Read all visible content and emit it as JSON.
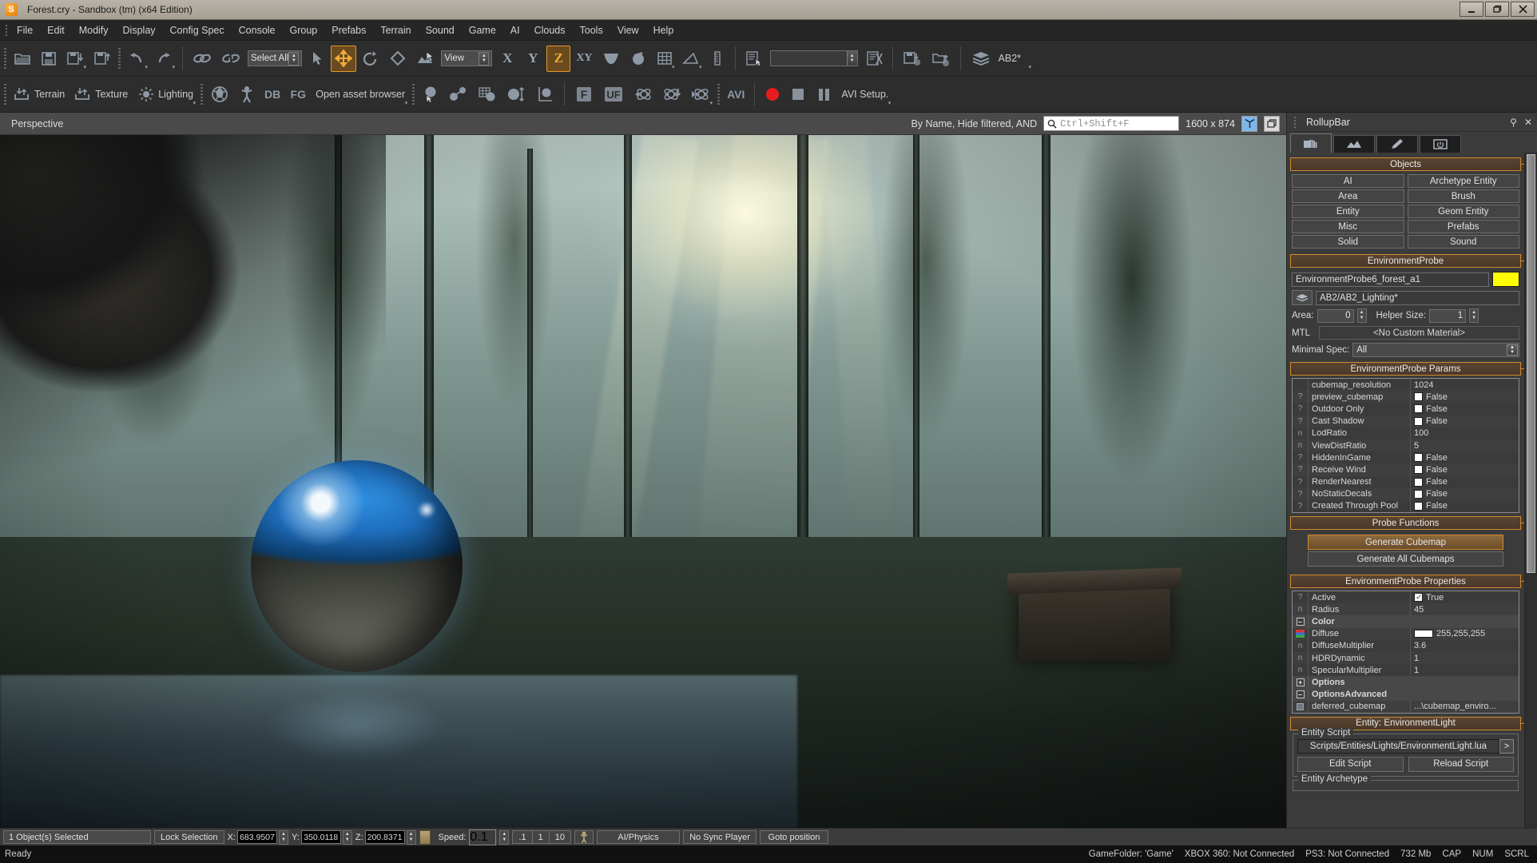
{
  "window": {
    "title": "Forest.cry - Sandbox (tm) (x64 Edition)",
    "app_icon": "sandbox-logo-icon",
    "minimize": "—",
    "maximize": "❐",
    "close": "✕"
  },
  "menubar": {
    "items": [
      "File",
      "Edit",
      "Modify",
      "Display",
      "Config Spec",
      "Console",
      "Group",
      "Prefabs",
      "Terrain",
      "Sound",
      "Game",
      "AI",
      "Clouds",
      "Tools",
      "View",
      "Help"
    ]
  },
  "toolbar_main": {
    "file_buttons": [
      {
        "name": "open-file-button",
        "icon": "folder-open-icon"
      },
      {
        "name": "save-file-button",
        "icon": "floppy-save-icon"
      },
      {
        "name": "export-button",
        "icon": "floppy-down-icon"
      },
      {
        "name": "import-button",
        "icon": "floppy-up-icon"
      }
    ],
    "undo_label": "undo-icon",
    "redo_label": "redo-icon",
    "link_label": "link-icon",
    "unlink_label": "unlink-icon",
    "select_combo_value": "Select All",
    "transform_buttons": [
      {
        "name": "select-mode-button",
        "icon": "cursor-arrow-icon",
        "active": false
      },
      {
        "name": "move-mode-button",
        "icon": "move-arrows-icon",
        "active": true
      },
      {
        "name": "rotate-mode-button",
        "icon": "rotate-icon",
        "active": false
      },
      {
        "name": "scale-mode-button",
        "icon": "scale-diamond-icon",
        "active": false
      },
      {
        "name": "select-terrain-button",
        "icon": "terrain-cursor-icon",
        "active": false
      }
    ],
    "view_combo_value": "View",
    "axis_buttons": [
      {
        "label": "X",
        "active": false
      },
      {
        "label": "Y",
        "active": false
      },
      {
        "label": "Z",
        "active": true
      },
      {
        "label": "XY",
        "active": false
      }
    ],
    "snap_buttons": [
      {
        "name": "terrain-snap-button",
        "icon": "valley-icon"
      },
      {
        "name": "object-snap-button",
        "icon": "object-pivot-icon"
      },
      {
        "name": "grid-snap-button",
        "icon": "grid-icon"
      },
      {
        "name": "angle-snap-button",
        "icon": "angle-icon"
      },
      {
        "name": "scale-snap-button",
        "icon": "ruler-icon"
      }
    ],
    "layer_tool_icon": "layer-list-icon",
    "layer_field_value": "",
    "goto_layer_icon": "goto-layer-icon",
    "save_level_resources_icon": "save-level-icon",
    "load_level_icon": "load-level-icon",
    "layers_icon": "layers-stack-icon",
    "layer_name": "AB2*"
  },
  "toolbar_editmode": {
    "items": [
      {
        "name": "terrain-button",
        "label": "Terrain",
        "icon": "terrain-import-icon"
      },
      {
        "name": "texture-button",
        "label": "Texture",
        "icon": "texture-import-icon"
      },
      {
        "name": "lighting-button",
        "label": "Lighting",
        "icon": "sun-icon"
      }
    ],
    "tools": [
      {
        "name": "ai-navigation-button",
        "icon": "globe-ai-icon"
      },
      {
        "name": "character-editor-button",
        "icon": "person-icon"
      },
      {
        "name": "database-view-button",
        "label": "DB"
      },
      {
        "name": "flowgraph-button",
        "label": "FG"
      },
      {
        "name": "asset-browser-button",
        "label": "Open asset browser"
      }
    ],
    "physics": [
      {
        "name": "goto-selection-button",
        "icon": "pick-object-icon"
      },
      {
        "name": "link-object-button",
        "icon": "link-objects-icon"
      },
      {
        "name": "align-to-grid-button",
        "icon": "align-grid-icon"
      },
      {
        "name": "align-to-object-button",
        "icon": "align-object-icon"
      },
      {
        "name": "set-height-button",
        "icon": "height-object-icon"
      }
    ],
    "freeze": [
      {
        "name": "freeze-button",
        "label": "F"
      },
      {
        "name": "unfreeze-button",
        "label": "UF"
      }
    ],
    "physics_sim": [
      {
        "name": "physics-reset-button",
        "icon": "atom-back-icon"
      },
      {
        "name": "physics-get-state-button",
        "icon": "atom-down-icon"
      },
      {
        "name": "physics-simulate-button",
        "icon": "atom-play-icon"
      }
    ],
    "avi": {
      "label": "AVI",
      "record": "record-dot-icon",
      "stop": "stop-square-icon",
      "pause": "pause-bars-icon",
      "setup_label": "AVI Setup."
    }
  },
  "viewport": {
    "label": "Perspective",
    "filter_text": "By Name, Hide filtered, AND",
    "search_placeholder": "Ctrl+Shift+F",
    "search_value": "",
    "search_icon": "magnifier-icon",
    "resolution": "1600 x 874",
    "axis_icon": "axis-helper-icon",
    "maximize_icon": "maximize-viewport-icon"
  },
  "rollup": {
    "title": "RollupBar",
    "pin_icon": "pin-icon",
    "close_icon": "close-icon",
    "tabs": [
      {
        "name": "objects-tab",
        "icon": "hand-cube-icon",
        "selected": true
      },
      {
        "name": "terrain-tab",
        "icon": "terrain-tab-icon",
        "selected": false
      },
      {
        "name": "modelling-tab",
        "icon": "pencil-icon",
        "selected": false
      },
      {
        "name": "display-tab",
        "icon": "monitor-icon",
        "selected": false
      }
    ],
    "objects": {
      "header": "Objects",
      "buttons": [
        "AI",
        "Archetype Entity",
        "Area",
        "Brush",
        "Entity",
        "Geom Entity",
        "Misc",
        "Prefabs",
        "Solid",
        "Sound"
      ]
    },
    "environment_probe": {
      "header": "EnvironmentProbe",
      "name_value": "EnvironmentProbe6_forest_a1",
      "color_swatch": "#ffff00",
      "layer_icon": "layers-stack-icon",
      "layer_value": "AB2/AB2_Lighting*",
      "area_label": "Area:",
      "area_value": "0",
      "helper_size_label": "Helper Size:",
      "helper_size_value": "1",
      "mtl_label": "MTL",
      "mtl_value": "<No Custom Material>",
      "minimal_spec_label": "Minimal Spec:",
      "minimal_spec_value": "All"
    },
    "probe_params": {
      "header": "EnvironmentProbe Params",
      "rows": [
        {
          "icon": "",
          "name": "cubemap_resolution",
          "type": "text",
          "value": "1024"
        },
        {
          "icon": "?",
          "name": "preview_cubemap",
          "type": "bool",
          "value": "False",
          "checked": false
        },
        {
          "icon": "?",
          "name": "Outdoor Only",
          "type": "bool",
          "value": "False",
          "checked": false
        },
        {
          "icon": "?",
          "name": "Cast Shadow",
          "type": "bool",
          "value": "False",
          "checked": false
        },
        {
          "icon": "n",
          "name": "LodRatio",
          "type": "text",
          "value": "100"
        },
        {
          "icon": "n",
          "name": "ViewDistRatio",
          "type": "text",
          "value": "5"
        },
        {
          "icon": "?",
          "name": "HiddenInGame",
          "type": "bool",
          "value": "False",
          "checked": false
        },
        {
          "icon": "?",
          "name": "Receive Wind",
          "type": "bool",
          "value": "False",
          "checked": false
        },
        {
          "icon": "?",
          "name": "RenderNearest",
          "type": "bool",
          "value": "False",
          "checked": false
        },
        {
          "icon": "?",
          "name": "NoStaticDecals",
          "type": "bool",
          "value": "False",
          "checked": false
        },
        {
          "icon": "?",
          "name": "Created Through Pool",
          "type": "bool",
          "value": "False",
          "checked": false
        }
      ]
    },
    "probe_functions": {
      "header": "Probe Functions",
      "generate_cubemap": "Generate Cubemap",
      "generate_all_cubemaps": "Generate All Cubemaps"
    },
    "probe_properties": {
      "header": "EnvironmentProbe Properties",
      "rows": [
        {
          "icon": "?",
          "name": "Active",
          "type": "bool",
          "value": "True",
          "checked": true
        },
        {
          "icon": "n",
          "name": "Radius",
          "type": "text",
          "value": "45"
        },
        {
          "icon": "-",
          "name": "Color",
          "type": "group",
          "value": ""
        },
        {
          "icon": "rgb",
          "name": "Diffuse",
          "type": "color",
          "value": "255,255,255",
          "swatch": "#ffffff"
        },
        {
          "icon": "n",
          "name": "DiffuseMultiplier",
          "type": "text",
          "value": "3.6"
        },
        {
          "icon": "n",
          "name": "HDRDynamic",
          "type": "text",
          "value": "1"
        },
        {
          "icon": "n",
          "name": "SpecularMultiplier",
          "type": "text",
          "value": "1"
        },
        {
          "icon": "+",
          "name": "Options",
          "type": "group",
          "value": ""
        },
        {
          "icon": "-",
          "name": "OptionsAdvanced",
          "type": "group",
          "value": ""
        },
        {
          "icon": "img",
          "name": "deferred_cubemap",
          "type": "text",
          "value": "...\\cubemap_enviro..."
        }
      ]
    },
    "entity": {
      "header": "Entity: EnvironmentLight",
      "script_legend": "Entity Script",
      "script_path": "Scripts/Entities/Lights/EnvironmentLight.lua",
      "script_browse": ">",
      "edit_script": "Edit Script",
      "reload_script": "Reload Script",
      "archetype_legend": "Entity Archetype"
    }
  },
  "statusbar": {
    "selection": "1 Object(s) Selected",
    "lock_selection": "Lock Selection",
    "coords": [
      {
        "axis": "X:",
        "value": "683.9507"
      },
      {
        "axis": "Y:",
        "value": "350.0118"
      },
      {
        "axis": "Z:",
        "value": "200.8371"
      }
    ],
    "lock_icon": "padlock-icon",
    "speed_label": "Speed:",
    "speed_value": "0.1",
    "speed_presets": [
      ".1",
      "1",
      "10"
    ],
    "person_icon": "person-speed-icon",
    "ai_physics": "AI/Physics",
    "sync_player": "No Sync Player",
    "goto_position": "Goto position"
  },
  "readybar": {
    "status": "Ready",
    "game_folder": "GameFolder: 'Game'",
    "xbox": "XBOX 360: Not Connected",
    "ps3": "PS3: Not Connected",
    "memory": "732 Mb",
    "cap": "CAP",
    "num": "NUM",
    "scrl": "SCRL"
  }
}
